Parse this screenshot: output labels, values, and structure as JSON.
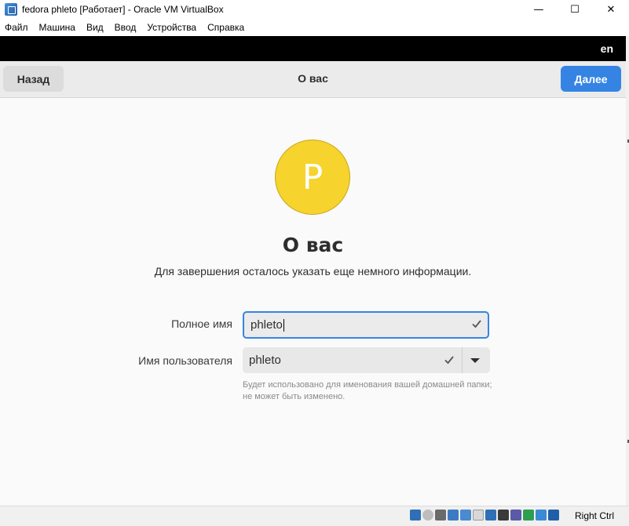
{
  "window": {
    "title": "fedora phleto [Работает] - Oracle VM VirtualBox",
    "controls": {
      "minimize": "—",
      "maximize": "☐",
      "close": "✕"
    }
  },
  "menu": [
    "Файл",
    "Машина",
    "Вид",
    "Ввод",
    "Устройства",
    "Справка"
  ],
  "guest": {
    "topbar": {
      "language": "en"
    },
    "header": {
      "back_label": "Назад",
      "title": "О вас",
      "next_label": "Далее"
    },
    "avatar": {
      "initial": "P",
      "color": "#f6d32d"
    },
    "heading": "О вас",
    "subtitle": "Для завершения осталось указать еще немного информации.",
    "full_name": {
      "label": "Полное имя",
      "value": "phleto"
    },
    "username": {
      "label": "Имя пользователя",
      "value": "phleto"
    },
    "hint": "Будет использовано для именования вашей домашней папки; не может быть изменено.",
    "accent_color": "#3584e4"
  },
  "statusbar": {
    "icons": [
      "hard-disk-icon",
      "optical-disk-icon",
      "audio-icon",
      "network-icon",
      "usb-icon",
      "shared-folders-icon",
      "display-icon",
      "video-capture-icon",
      "cpu-icon",
      "guest-additions-icon",
      "mouse-integration-icon",
      "keyboard-capture-icon"
    ],
    "host_key": "Right Ctrl"
  }
}
